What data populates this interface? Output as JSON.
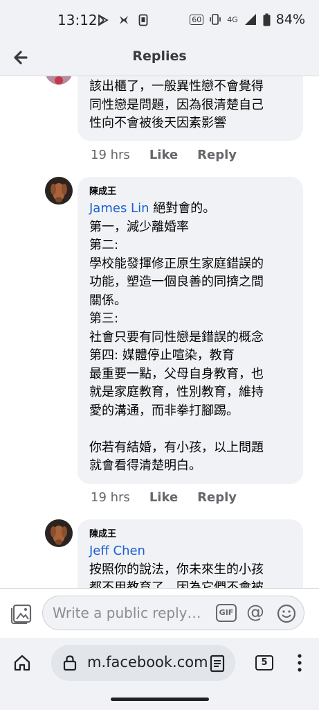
{
  "status_bar": {
    "time": "13:12",
    "network": "4G",
    "battery": "84%",
    "refresh_badge": "60"
  },
  "header": {
    "title": "Replies"
  },
  "comments": [
    {
      "text": "該出櫃了，一般異性戀不會覺得\n同性戀是問題，因為很清楚自己\n性向不會被後天因素影響",
      "time": "19 hrs",
      "like": "Like",
      "reply": "Reply"
    },
    {
      "author": "陳成王",
      "mention": "James Lin",
      "text_after_mention": " 絕對會的。",
      "text": "第一，減少離婚率\n第二:\n學校能發揮修正原生家庭錯誤的\n功能，塑造一個良善的同擠之間\n關係。\n第三:\n社會只要有同性戀是錯誤的概念\n第四: 媒體停止喧染，教育\n最重要一點，父母自身教育，也\n就是家庭教育，性別教育，維持\n愛的溝通，而非拳打腳踢。\n\n你若有結婚，有小孩，以上問題\n就會看得清楚明白。",
      "time": "19 hrs",
      "like": "Like",
      "reply": "Reply"
    },
    {
      "author": "陳成王",
      "mention": "Jeff Chen",
      "text": "按照你的說法，你未來生的小孩\n都不用教育了，因為它們不會被"
    }
  ],
  "composer": {
    "placeholder": "Write a public reply…",
    "gif_label": "GIF",
    "at_label": "@"
  },
  "browser": {
    "url": "m.facebook.com",
    "tab_count": "5"
  }
}
